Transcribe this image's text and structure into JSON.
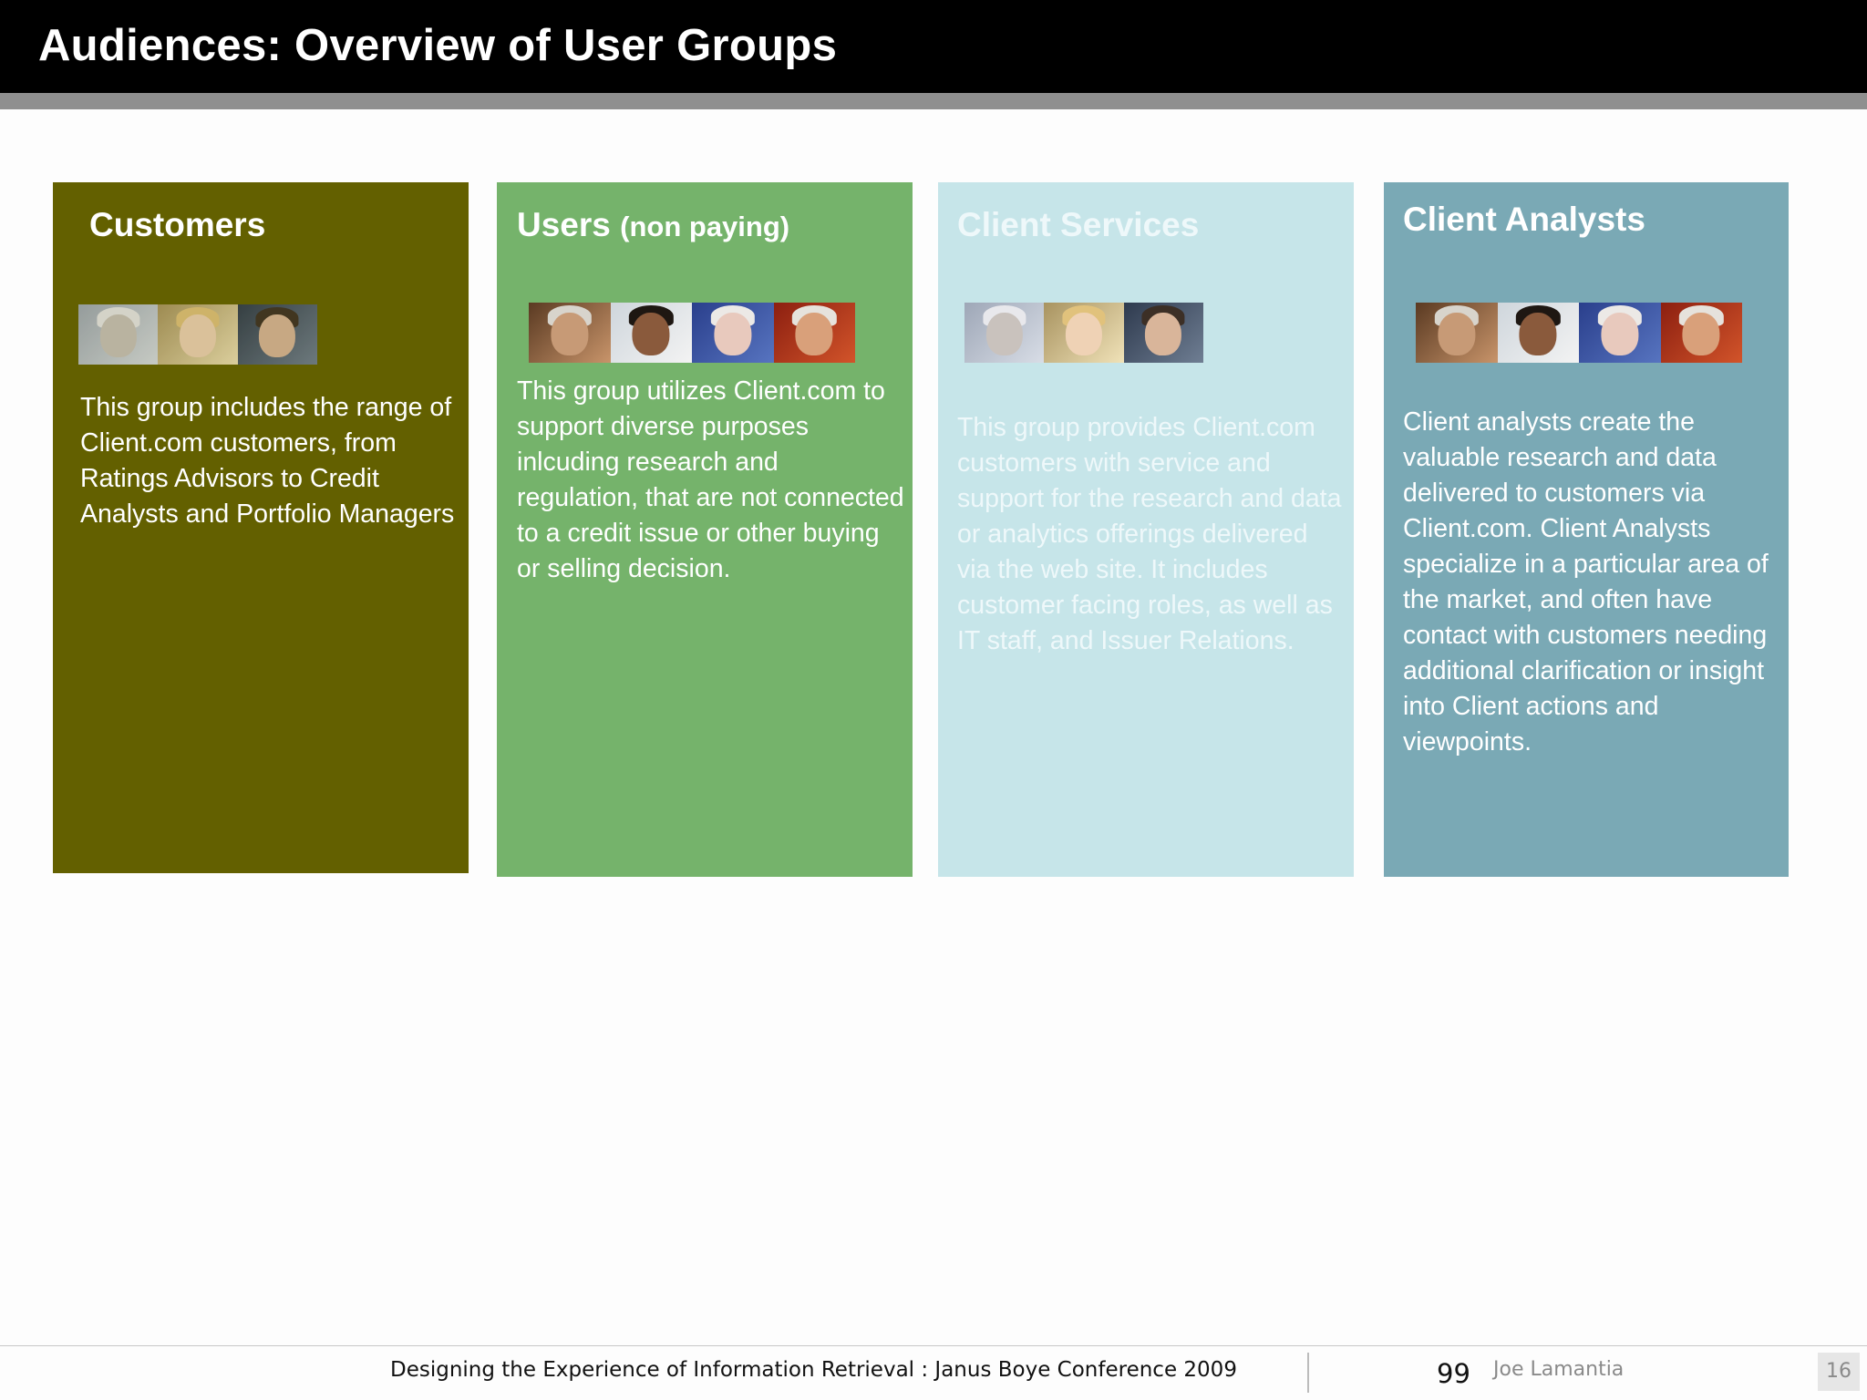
{
  "slide": {
    "title": "Audiences: Overview of User Groups"
  },
  "colors": {
    "title_bar": "#000000",
    "title_rule": "#8f8f8f",
    "customers": "#636000",
    "users": "#75b36b",
    "client_services": "#c6e5e9",
    "client_analysts": "#7aa9b5"
  },
  "cards": [
    {
      "title": "Customers",
      "subtitle": "",
      "body": "This group includes the range of Client.com customers, from Ratings Advisors to Credit Analysts and Portfolio Managers"
    },
    {
      "title": "Users",
      "subtitle": "(non paying)",
      "body": "This group utilizes Client.com to support diverse purposes inlcuding research and regulation, that are not connected to a credit issue or other buying or selling decision."
    },
    {
      "title": "Client Services",
      "subtitle": "",
      "body": "This group provides Client.com customers with service and support for the research and data or analytics offerings delivered via the web site.  It includes customer facing roles, as well as IT staff, and Issuer Relations."
    },
    {
      "title": "Client Analysts",
      "subtitle": "",
      "body": "Client analysts create the valuable research and data delivered to customers via Client.com.  Client Analysts specialize in a particular area of the market, and often have contact with customers needing additional clarification or insight into Client actions and viewpoints."
    }
  ],
  "footer": {
    "presentation": "Designing the Experience of Information Retrieval : Janus Boye Conference 2009",
    "number": "99",
    "author": "Joe Lamantia",
    "slide_number": "16"
  }
}
